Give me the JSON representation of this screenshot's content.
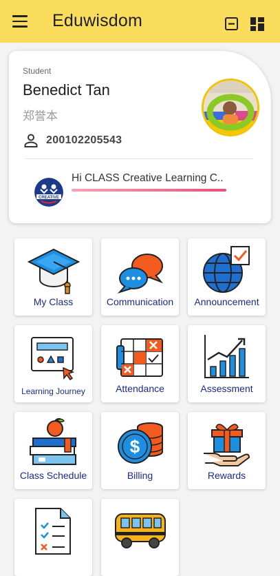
{
  "app": {
    "title": "Eduwisdom"
  },
  "header": {
    "menu_icon": "hamburger-menu-icon",
    "actions": [
      "minimize-square-icon",
      "dashboard-grid-icon"
    ]
  },
  "student": {
    "role": "Student",
    "name": "Benedict Tan",
    "chinese_name": "郑誉本",
    "id": "200102205543",
    "school": "Hi CLASS Creative Learning C..",
    "school_logo_text": "CREATIVE"
  },
  "menu": [
    {
      "label": "My Class",
      "icon": "graduation-cap-icon"
    },
    {
      "label": "Communication",
      "icon": "chat-bubbles-icon"
    },
    {
      "label": "Announcement",
      "icon": "globe-checkbox-icon"
    },
    {
      "label": "Learning Journey",
      "icon": "learning-board-icon"
    },
    {
      "label": "Attendance",
      "icon": "attendance-calendar-icon"
    },
    {
      "label": "Assessment",
      "icon": "growth-chart-icon"
    },
    {
      "label": "Class Schedule",
      "icon": "books-apple-icon"
    },
    {
      "label": "Billing",
      "icon": "coins-dollar-icon"
    },
    {
      "label": "Rewards",
      "icon": "gift-hand-icon"
    },
    {
      "label": "",
      "icon": "checklist-document-icon"
    },
    {
      "label": "",
      "icon": "school-bus-icon"
    }
  ],
  "colors": {
    "appbar": "#f9dc5c",
    "tile_label": "#1a2a8c",
    "avatar_ring": "#f5c200"
  }
}
